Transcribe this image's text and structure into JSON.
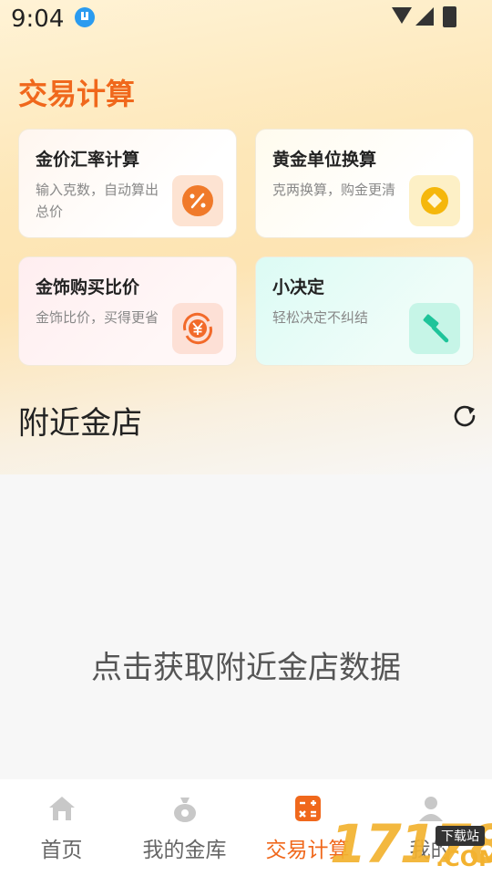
{
  "status": {
    "time": "9:04"
  },
  "header": {
    "title": "交易计算"
  },
  "cards": [
    {
      "title": "金价汇率计算",
      "subtitle": "输入克数，自动算出总价",
      "icon": "percent-icon",
      "color": "#f07a2a"
    },
    {
      "title": "黄金单位换算",
      "subtitle": "克两换算，购金更清",
      "icon": "diamond-coin-icon",
      "color": "#f5b70c"
    },
    {
      "title": "金饰购买比价",
      "subtitle": "金饰比价，买得更省",
      "icon": "yuan-exchange-icon",
      "color": "#f26a2a"
    },
    {
      "title": "小决定",
      "subtitle": "轻松决定不纠结",
      "icon": "gavel-icon",
      "color": "#1fc49a"
    }
  ],
  "nearby": {
    "title": "附近金店",
    "empty_text": "点击获取附近金店数据"
  },
  "tabbar": {
    "items": [
      {
        "label": "首页",
        "icon": "home-icon",
        "active": false
      },
      {
        "label": "我的金库",
        "icon": "money-bag-icon",
        "active": false
      },
      {
        "label": "交易计算",
        "icon": "calculator-icon",
        "active": true
      },
      {
        "label": "我的",
        "icon": "user-icon",
        "active": false
      }
    ]
  },
  "watermark": {
    "number": "17178",
    "tag": "下载站",
    "suffix": ".COM"
  },
  "colors": {
    "accent": "#f0681c",
    "inactive_tab": "#666666"
  }
}
